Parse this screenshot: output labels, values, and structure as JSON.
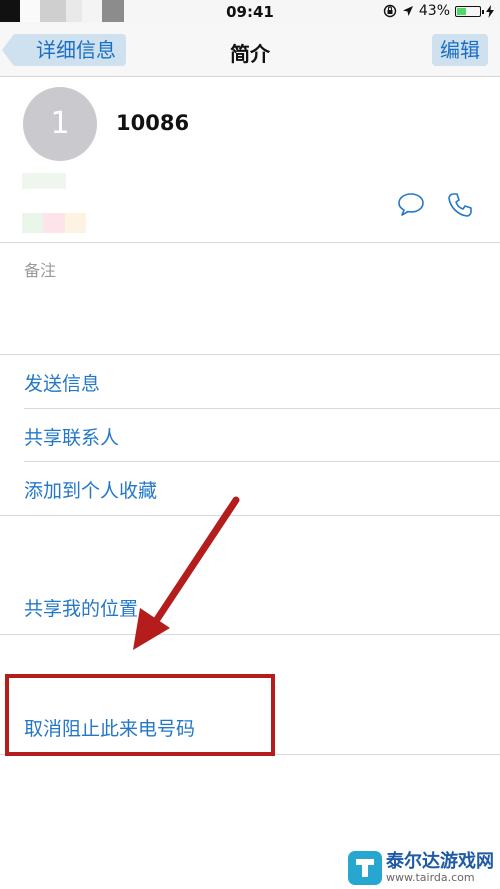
{
  "status_bar": {
    "time": "09:41",
    "battery_percent": "43%",
    "battery_level": 0.43
  },
  "nav": {
    "back_label": "详细信息",
    "title": "简介",
    "edit_label": "编辑"
  },
  "contact": {
    "avatar_initial": "1",
    "name": "10086"
  },
  "notes_label": "备注",
  "actions": [
    {
      "label": "发送信息"
    },
    {
      "label": "共享联系人"
    },
    {
      "label": "添加到个人收藏"
    },
    {
      "label": "共享我的位置"
    },
    {
      "label": "取消阻止此来电号码"
    }
  ],
  "icons": {
    "message": "message-bubble-icon",
    "call": "phone-icon",
    "location": "location-arrow-icon",
    "lock": "rotation-lock-icon"
  },
  "colors": {
    "accent": "#2478c8",
    "annotation": "#b51c1c",
    "battery": "#4cd964"
  },
  "watermark": {
    "title": "泰尔达游戏网",
    "url": "www.tairda.com"
  }
}
